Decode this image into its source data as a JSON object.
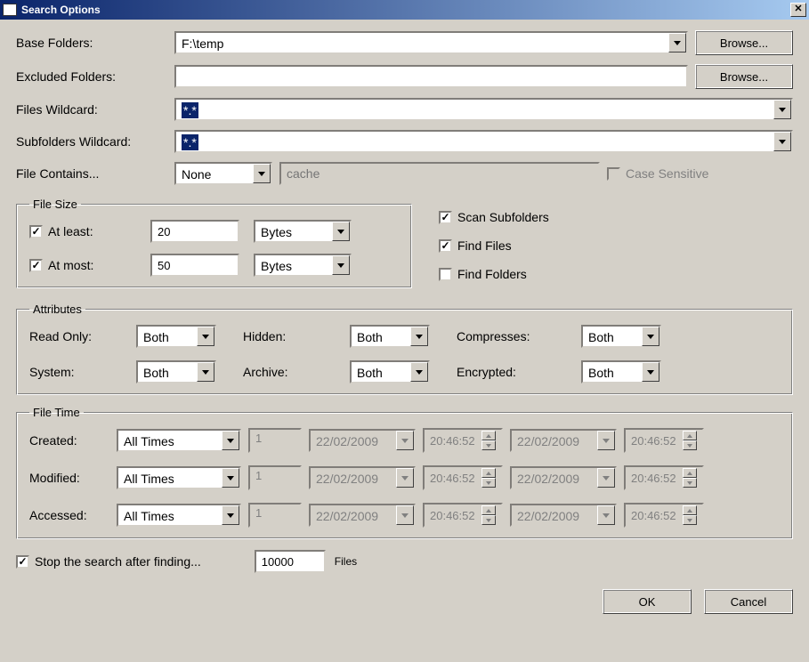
{
  "title": "Search Options",
  "labels": {
    "base_folders": "Base Folders:",
    "excluded_folders": "Excluded Folders:",
    "files_wildcard": "Files Wildcard:",
    "subfolders_wildcard": "Subfolders Wildcard:",
    "file_contains": "File Contains...",
    "case_sensitive": "Case Sensitive",
    "file_size": "File Size",
    "at_least": "At least:",
    "at_most": "At most:",
    "bytes": "Bytes",
    "scan_subfolders": "Scan Subfolders",
    "find_files": "Find Files",
    "find_folders": "Find Folders",
    "attributes": "Attributes",
    "read_only": "Read Only:",
    "hidden": "Hidden:",
    "compresses": "Compresses:",
    "system": "System:",
    "archive": "Archive:",
    "encrypted": "Encrypted:",
    "both": "Both",
    "file_time": "File Time",
    "created": "Created:",
    "modified": "Modified:",
    "accessed": "Accessed:",
    "all_times": "All Times",
    "stop_after": "Stop the search after finding...",
    "files_suffix": "Files",
    "browse": "Browse...",
    "ok": "OK",
    "cancel": "Cancel",
    "none": "None"
  },
  "values": {
    "base_folders": "F:\\temp",
    "excluded_folders": "",
    "files_wildcard": "*.*",
    "subfolders_wildcard": "*.*",
    "file_contains_select": "None",
    "file_contains_placeholder": "cache",
    "at_least": "20",
    "at_most": "50",
    "stop_count": "10000",
    "ft_num": "1",
    "ft_date": "22/02/2009",
    "ft_time": "20:46:52"
  },
  "checks": {
    "at_least": true,
    "at_most": true,
    "scan_subfolders": true,
    "find_files": true,
    "find_folders": false,
    "case_sensitive": false,
    "stop_after": true
  }
}
